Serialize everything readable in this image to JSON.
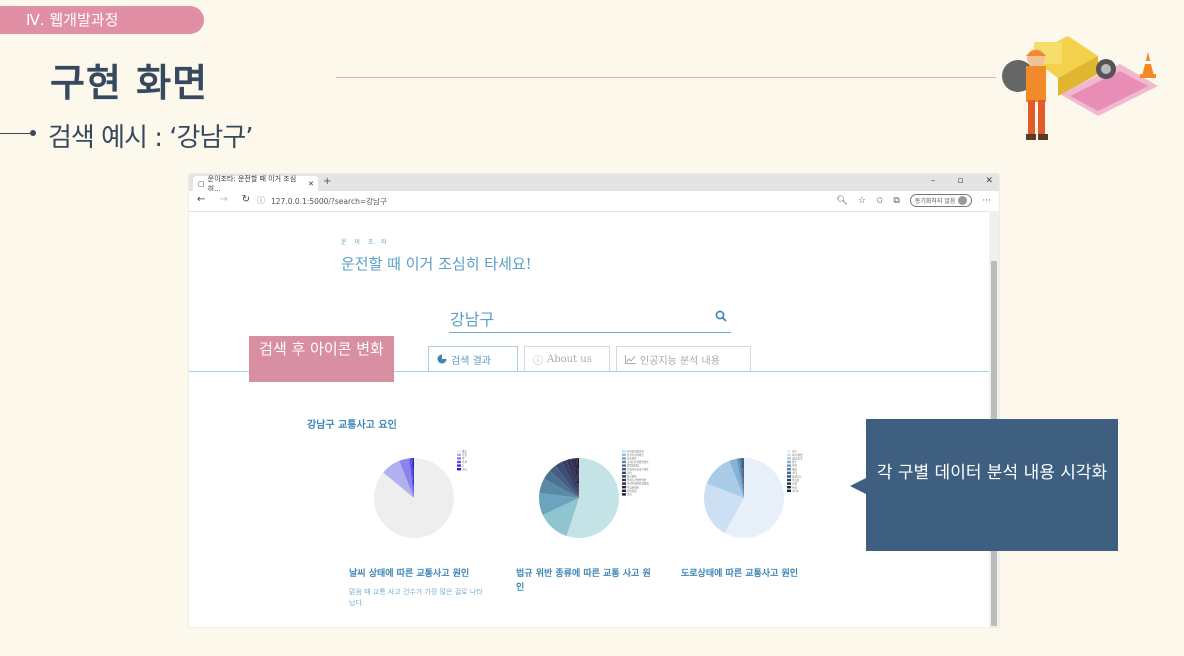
{
  "slide": {
    "section_tag": "Ⅳ.  웹개발과정",
    "title": "구현 화면",
    "subheading": "검색 예시 : ‘강남구’"
  },
  "browser": {
    "tab_title": "운이조타: 운전할 때 이거 조심히...",
    "url": "127.0.0.1:5000/?search=강남구",
    "sync_label": "동기화하지 않음"
  },
  "page": {
    "brand_small": "운 이 조 타",
    "brand_main": "운전할 때 이거 조심히 타세요!",
    "search": {
      "value": "강남구"
    },
    "tabs": [
      {
        "label": "검색 결과",
        "icon": "pie-icon"
      },
      {
        "label": "About us",
        "icon": "info-icon"
      },
      {
        "label": "인공지능 분석 내용",
        "icon": "line-chart-icon"
      }
    ],
    "section_heading": "강남구 교통사고 요인",
    "cards": [
      {
        "caption": "날씨 상태에 따른 교통사고 원인",
        "description": "맑음 때 교통 사고 건수가 가장 많은 걸로 나타났다."
      },
      {
        "caption": "법규 위반 종류에 따른 교통 사고 원인",
        "description": ""
      },
      {
        "caption": "도로상태에 따른 교통사고 원인",
        "description": ""
      }
    ]
  },
  "annotations": {
    "pink": "검색 후 아이콘 변화",
    "blue": "각 구별 데이터 분석 내용 시각화"
  },
  "colors": {
    "accent": "#5aa0c6",
    "pink": "#d88fa1",
    "navy": "#3e5f80",
    "title": "#36495f"
  },
  "chart_data": [
    {
      "type": "pie",
      "title": "",
      "categories": [
        "맑음",
        "흐림",
        "비",
        "안개",
        "눈",
        "기타"
      ],
      "values": [
        86,
        8,
        4,
        1,
        0.5,
        0.5
      ],
      "slice_colors": [
        "#eeeeee",
        "#b3b0f2",
        "#8b84f0",
        "#5c54ea",
        "#3f35d8",
        "#2a20b8"
      ],
      "legend": "top-right"
    },
    {
      "type": "pie",
      "title": "",
      "categories": [
        "안전운전불이행",
        "안전거리미확보",
        "신호위반",
        "교차로운행방법위반",
        "중앙선침범",
        "보행자보호의무위반",
        "기타",
        "차로위반",
        "앞지르기방법위반",
        "직진우회전진행방해",
        "부당한회전",
        "정비불량",
        "과속"
      ],
      "values": [
        55,
        13,
        9,
        6,
        4,
        3,
        3,
        2,
        2,
        1,
        1,
        0.5,
        0.5
      ],
      "slice_colors": [
        "#c3e3e6",
        "#8fc5d0",
        "#6aa5bd",
        "#5a8aa8",
        "#4c7394",
        "#445f82",
        "#3d4d72",
        "#383f64",
        "#343458",
        "#302b4e",
        "#2b2545",
        "#27203d",
        "#221b35"
      ],
      "legend": "top-right"
    },
    {
      "type": "pie",
      "title": "",
      "categories": [
        "건조",
        "서리/결빙",
        "젖음/습기",
        "침수",
        "적설",
        "해빙",
        "기타",
        "포장도로",
        "비포장",
        "교량",
        "터널",
        "기타2"
      ],
      "values": [
        58,
        23,
        13,
        3,
        1,
        0.5,
        0.5,
        0.3,
        0.2,
        0.2,
        0.2,
        0.1
      ],
      "slice_colors": [
        "#e7eff9",
        "#cddff2",
        "#a8cbe7",
        "#84b3d7",
        "#6699c2",
        "#4f80aa",
        "#3f6a92",
        "#33577c",
        "#2a4768",
        "#223a57",
        "#1b2f48",
        "#14243a"
      ],
      "legend": "top-right"
    }
  ]
}
